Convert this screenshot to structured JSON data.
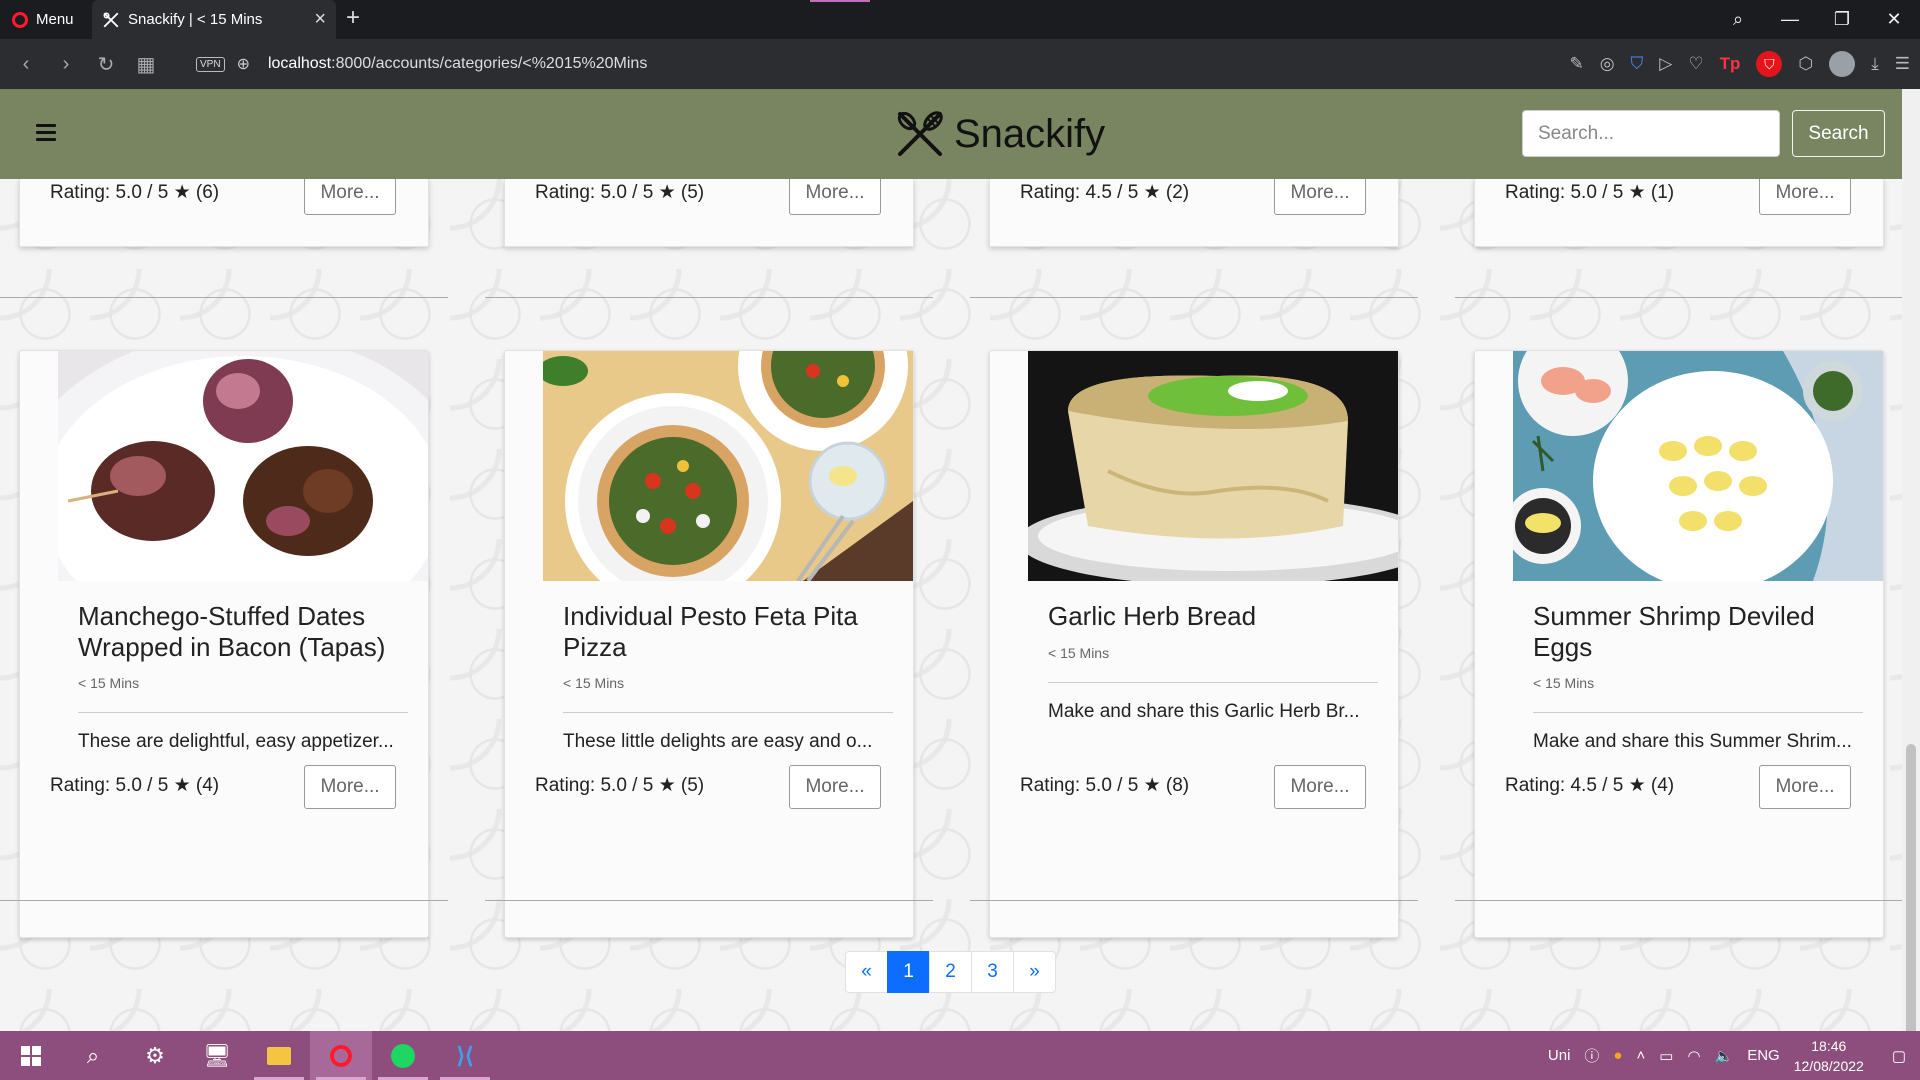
{
  "browser": {
    "menu_label": "Menu",
    "tab_title": "Snackify | < 15 Mins",
    "url_host": "localhost",
    "url_path": ":8000/accounts/categories/<%2015%20Mins",
    "vpn_label": "VPN"
  },
  "navbar": {
    "brand": "Snackify",
    "search_placeholder": "Search...",
    "search_button": "Search"
  },
  "top_row": [
    {
      "rating": "Rating: 5.0 / 5 ★ (6)",
      "more": "More..."
    },
    {
      "rating": "Rating: 5.0 / 5 ★ (5)",
      "more": "More..."
    },
    {
      "rating": "Rating: 4.5 / 5 ★ (2)",
      "more": "More..."
    },
    {
      "rating": "Rating: 5.0 / 5 ★ (1)",
      "more": "More..."
    }
  ],
  "cards": [
    {
      "title": "Manchego-Stuffed Dates Wrapped in Bacon (Tapas)",
      "time": "< 15 Mins",
      "description": "These are delightful, easy appetizer...",
      "rating": "Rating: 5.0 / 5 ★ (4)",
      "more": "More..."
    },
    {
      "title": "Individual Pesto Feta Pita Pizza",
      "time": "< 15 Mins",
      "description": "These little delights are easy and o...",
      "rating": "Rating: 5.0 / 5 ★ (5)",
      "more": "More..."
    },
    {
      "title": "Garlic Herb Bread",
      "time": "< 15 Mins",
      "description": "Make and share this Garlic Herb Br...",
      "rating": "Rating: 5.0 / 5 ★ (8)",
      "more": "More..."
    },
    {
      "title": "Summer Shrimp Deviled Eggs",
      "time": "< 15 Mins",
      "description": "Make and share this Summer Shrim...",
      "rating": "Rating: 4.5 / 5 ★ (4)",
      "more": "More..."
    }
  ],
  "pagination": {
    "prev": "«",
    "pages": [
      "1",
      "2",
      "3"
    ],
    "active": "1",
    "next": "»"
  },
  "taskbar": {
    "input_indicator": "Uni",
    "language": "ENG",
    "time": "18:46",
    "date": "12/08/2022"
  }
}
